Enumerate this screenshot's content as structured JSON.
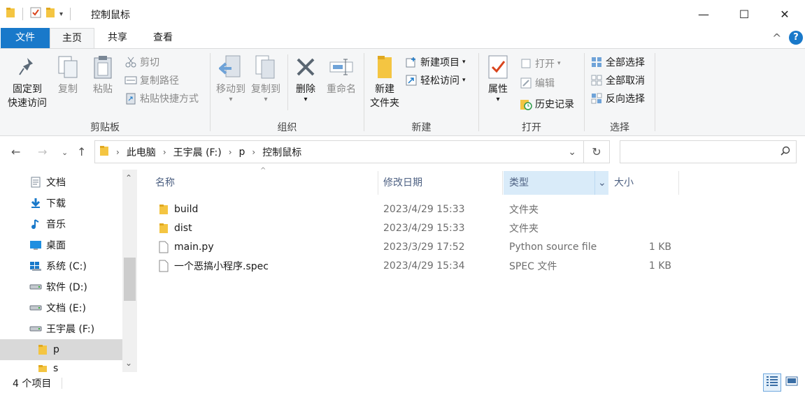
{
  "window": {
    "title": "控制鼠标",
    "minimize_glyph": "—",
    "maximize_glyph": "☐",
    "close_glyph": "✕"
  },
  "tabs": [
    {
      "label": "文件"
    },
    {
      "label": "主页"
    },
    {
      "label": "共享"
    },
    {
      "label": "查看"
    }
  ],
  "ribbon": {
    "clipboard": {
      "label": "剪贴板",
      "pin": {
        "line1": "固定到",
        "line2": "快速访问"
      },
      "copy": "复制",
      "paste": "粘贴",
      "cut": "剪切",
      "copy_path": "复制路径",
      "paste_shortcut": "粘贴快捷方式"
    },
    "organize": {
      "label": "组织",
      "move_to": "移动到",
      "copy_to": "复制到",
      "delete": "删除",
      "rename": "重命名"
    },
    "new": {
      "label": "新建",
      "new_folder": {
        "line1": "新建",
        "line2": "文件夹"
      },
      "new_item": "新建项目",
      "easy_access": "轻松访问"
    },
    "open": {
      "label": "打开",
      "properties": "属性",
      "open": "打开",
      "edit": "编辑",
      "history": "历史记录"
    },
    "select": {
      "label": "选择",
      "select_all": "全部选择",
      "select_none": "全部取消",
      "invert": "反向选择"
    }
  },
  "address": {
    "crumbs": [
      "此电脑",
      "王宇晨 (F:)",
      "p",
      "控制鼠标"
    ],
    "search_placeholder": ""
  },
  "navpane": {
    "items": [
      {
        "label": "文档",
        "icon": "document-icon"
      },
      {
        "label": "下载",
        "icon": "download-icon"
      },
      {
        "label": "音乐",
        "icon": "music-icon"
      },
      {
        "label": "桌面",
        "icon": "desktop-icon"
      },
      {
        "label": "系统 (C:)",
        "icon": "windows-drive-icon"
      },
      {
        "label": "软件 (D:)",
        "icon": "drive-icon"
      },
      {
        "label": "文档 (E:)",
        "icon": "drive-icon"
      },
      {
        "label": "王宇晨 (F:)",
        "icon": "drive-icon"
      },
      {
        "label": "p",
        "icon": "folder-icon"
      },
      {
        "label": "s",
        "icon": "folder-icon"
      }
    ]
  },
  "columns": {
    "name": "名称",
    "date": "修改日期",
    "type": "类型",
    "size": "大小"
  },
  "files": [
    {
      "name": "build",
      "date": "2023/4/29 15:33",
      "type": "文件夹",
      "size": "",
      "icon": "folder-icon"
    },
    {
      "name": "dist",
      "date": "2023/4/29 15:33",
      "type": "文件夹",
      "size": "",
      "icon": "folder-icon"
    },
    {
      "name": "main.py",
      "date": "2023/3/29 17:52",
      "type": "Python source file",
      "size": "1 KB",
      "icon": "file-icon"
    },
    {
      "name": "一个恶搞小程序.spec",
      "date": "2023/4/29 15:34",
      "type": "SPEC 文件",
      "size": "1 KB",
      "icon": "file-icon"
    }
  ],
  "status": {
    "count": "4 个项目"
  },
  "colors": {
    "accent": "#1979ca",
    "selection": "#d9ebf9",
    "folder": "#f4c542"
  }
}
